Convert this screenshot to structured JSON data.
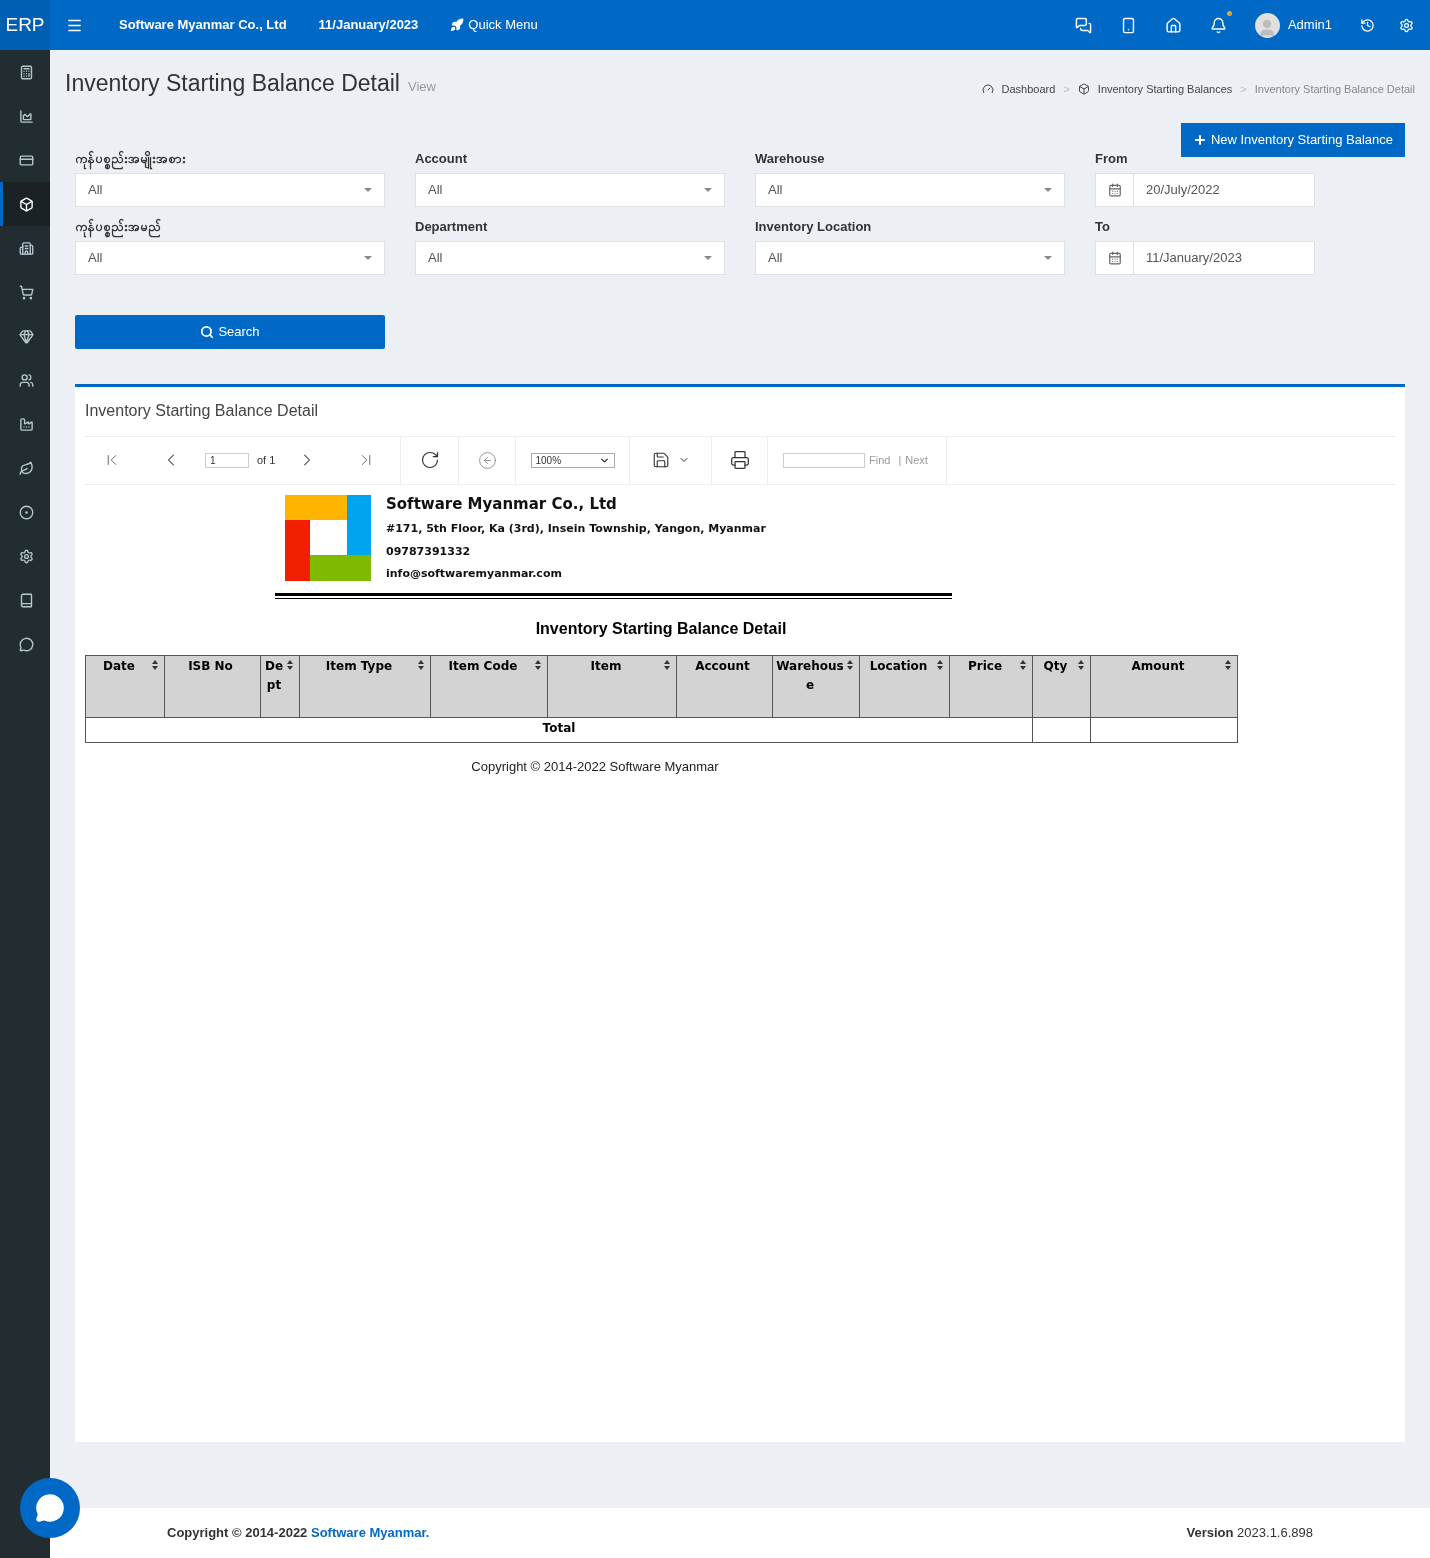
{
  "topbar": {
    "logo": "ERP",
    "company": "Software Myanmar Co., Ltd",
    "date": "11/January/2023",
    "quick_menu": "Quick Menu",
    "user": "Admin1",
    "notification_dot": true
  },
  "sidebar": {
    "items": [
      {
        "selected": false
      },
      {
        "selected": false
      },
      {
        "selected": false
      },
      {
        "selected": true
      },
      {
        "selected": false
      },
      {
        "selected": false
      },
      {
        "selected": false
      },
      {
        "selected": false
      },
      {
        "selected": false
      },
      {
        "selected": false
      },
      {
        "selected": false
      },
      {
        "selected": false
      },
      {
        "selected": false
      },
      {
        "selected": false
      }
    ]
  },
  "page": {
    "title": "Inventory Starting Balance Detail",
    "subtitle": "View",
    "breadcrumb": [
      {
        "label": "Dashboard"
      },
      {
        "label": "Inventory Starting Balances"
      },
      {
        "label": "Inventory Starting Balance Detail"
      }
    ],
    "breadcrumb_separator": ">",
    "new_button": "New Inventory Starting Balance"
  },
  "filters": [
    {
      "label": "ကုန်ပစ္စည်းအမျိုးအစား",
      "kind": "select",
      "value": "All"
    },
    {
      "label": "Account",
      "kind": "select",
      "value": "All"
    },
    {
      "label": "Warehouse",
      "kind": "select",
      "value": "All"
    },
    {
      "label": "From",
      "kind": "date",
      "value": "20/July/2022"
    },
    {
      "label": "ကုန်ပစ္စည်းအမည်",
      "kind": "select",
      "value": "All"
    },
    {
      "label": "Department",
      "kind": "select",
      "value": "All"
    },
    {
      "label": "Inventory Location",
      "kind": "select",
      "value": "All"
    },
    {
      "label": "To",
      "kind": "date",
      "value": "11/January/2023"
    }
  ],
  "search_button": "Search",
  "report": {
    "panel_title": "Inventory Starting Balance Detail",
    "toolbar": {
      "page": "1",
      "of": "of 1",
      "zoom": "100%",
      "find": "Find",
      "separator": "|",
      "next": "Next"
    },
    "company": {
      "name": "Software Myanmar Co., Ltd",
      "address": "#171, 5th Floor, Ka (3rd), Insein Township, Yangon, Myanmar",
      "phone": "09787391332",
      "email": "info@softwaremyanmar.com"
    },
    "title": "Inventory Starting Balance Detail",
    "table": {
      "columns": [
        {
          "label": "Date",
          "sortable": true
        },
        {
          "label": "ISB No",
          "sortable": false
        },
        {
          "label": "Dept",
          "sortable": true
        },
        {
          "label": "Item Type",
          "sortable": true
        },
        {
          "label": "Item Code",
          "sortable": true
        },
        {
          "label": "Item",
          "sortable": true
        },
        {
          "label": "Account",
          "sortable": false
        },
        {
          "label": "Warehouse",
          "sortable": true
        },
        {
          "label": "Location",
          "sortable": true
        },
        {
          "label": "Price",
          "sortable": true
        },
        {
          "label": "Qty",
          "sortable": true
        },
        {
          "label": "Amount",
          "sortable": true
        }
      ],
      "total_label": "Total"
    },
    "copyright": "Copyright © 2014-2022 Software Myanmar"
  },
  "footer": {
    "copyright": "Copyright © 2014-2022",
    "link": "Software Myanmar.",
    "version_label": "Version",
    "version": "2023.1.6.898"
  }
}
